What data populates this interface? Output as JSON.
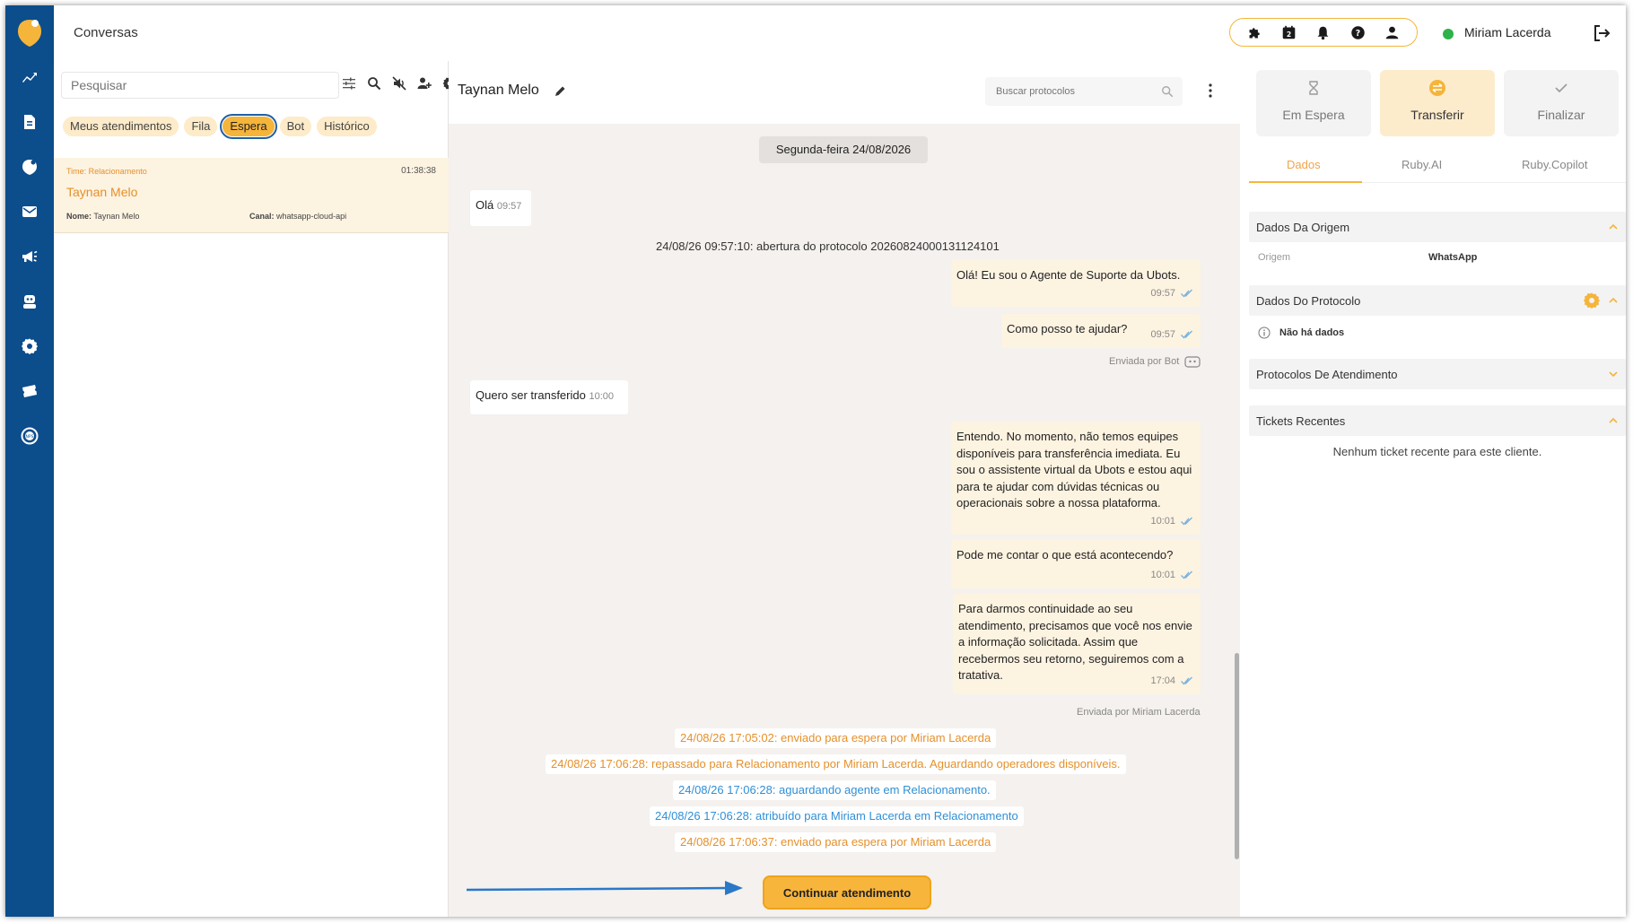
{
  "app": {
    "title": "Conversas",
    "user_name": "Miriam Lacerda",
    "user_status_color": "#2db34a",
    "brand_color": "#0c4d8c",
    "accent_color": "#f5b43a"
  },
  "sidebar": {
    "items": [
      {
        "icon": "analytics-icon"
      },
      {
        "icon": "document-icon"
      },
      {
        "icon": "shield-icon"
      },
      {
        "icon": "mail-icon"
      },
      {
        "icon": "megaphone-icon"
      },
      {
        "icon": "bot-icon"
      },
      {
        "icon": "gear-icon"
      },
      {
        "icon": "ticket-icon"
      },
      {
        "icon": "nps-icon"
      }
    ]
  },
  "topbar": {
    "icons": [
      "puzzle-icon",
      "calendar-badge-icon",
      "bell-icon",
      "help-icon",
      "user-icon"
    ]
  },
  "list": {
    "search_placeholder": "Pesquisar",
    "filters": [
      "Meus atendimentos",
      "Fila",
      "Espera",
      "Bot",
      "Histórico"
    ],
    "active_filter": "Espera",
    "conversations": [
      {
        "team": "Time: Relacionamento",
        "time": "01:38:38",
        "name": "Taynan Melo",
        "name_label": "Nome:",
        "name_value": "Taynan Melo",
        "channel_label": "Canal:",
        "channel_value": "whatsapp-cloud-api"
      }
    ]
  },
  "chat": {
    "contact_name": "Taynan Melo",
    "protocol_search_placeholder": "Buscar protocolos",
    "day_label": "Segunda-feira 24/08/2026",
    "messages": [
      {
        "dir": "in",
        "text": "Olá",
        "time": "09:57"
      },
      {
        "dir": "sys",
        "text": "24/08/26 09:57:10: abertura do protocolo 20260824000131124101"
      },
      {
        "dir": "out",
        "text": "Olá! Eu sou o Agente de Suporte da Ubots.",
        "time": "09:57"
      },
      {
        "dir": "out",
        "text": "Como posso te ajudar?",
        "time": "09:57"
      },
      {
        "dir": "out",
        "text": "Entendo. No momento, não temos equipes disponíveis para transferência imediata. Eu sou o assistente virtual da Ubots e estou aqui para te ajudar com dúvidas técnicas ou operacionais sobre a nossa plataforma.",
        "time": "10:01"
      },
      {
        "dir": "out",
        "text": "Pode me contar o que está acontecendo?",
        "time": "10:01"
      },
      {
        "dir": "in",
        "text": "Quero ser transferido",
        "time": "10:00"
      },
      {
        "dir": "out",
        "text": "Para darmos continuidade ao seu atendimento, precisamos que você nos envie a informação solicitada. Assim que recebermos seu retorno, seguiremos com a tratativa.",
        "time": "17:04"
      }
    ],
    "sent_by_bot": "Enviada por Bot",
    "sent_by_agent": "Enviada por Miriam Lacerda",
    "events": [
      {
        "text": "24/08/26 17:05:02: enviado para espera por Miriam Lacerda",
        "color": "#e5902a"
      },
      {
        "text": "24/08/26 17:06:28: repassado para Relacionamento por Miriam Lacerda. Aguardando operadores disponíveis.",
        "color": "#e5902a"
      },
      {
        "text": "24/08/26 17:06:28: aguardando agente em Relacionamento.",
        "color": "#2f8fd6"
      },
      {
        "text": "24/08/26 17:06:28: atribuído para Miriam Lacerda em Relacionamento",
        "color": "#2f8fd6"
      },
      {
        "text": "24/08/26 17:06:37: enviado para espera por Miriam Lacerda",
        "color": "#e5902a"
      }
    ],
    "continue_label": "Continuar atendimento"
  },
  "details": {
    "actions": [
      {
        "label": "Em Espera",
        "icon": "hourglass-icon"
      },
      {
        "label": "Transferir",
        "icon": "transfer-icon"
      },
      {
        "label": "Finalizar",
        "icon": "check-icon"
      }
    ],
    "tabs": [
      "Dados",
      "Ruby.AI",
      "Ruby.Copilot"
    ],
    "active_tab": "Dados",
    "sections": {
      "origem_title": "Dados Da Origem",
      "origem_label": "Origem",
      "origem_value": "WhatsApp",
      "protocolo_title": "Dados Do Protocolo",
      "protocolo_empty": "Não há dados",
      "protocolos_title": "Protocolos De Atendimento",
      "tickets_title": "Tickets Recentes",
      "tickets_empty": "Nenhum ticket recente para este cliente."
    }
  }
}
